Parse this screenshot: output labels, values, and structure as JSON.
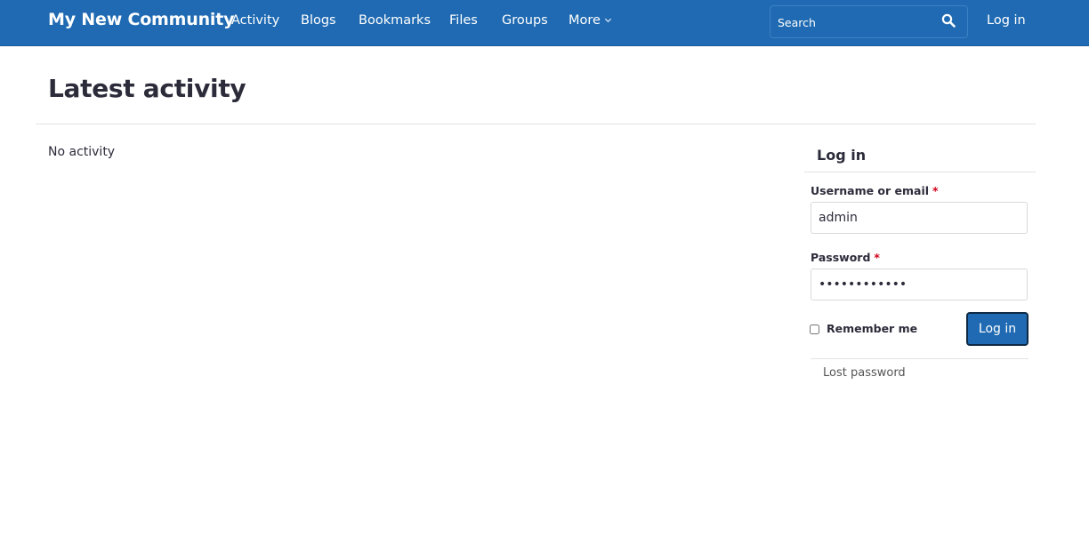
{
  "navbar": {
    "brand": "My New Community",
    "items": [
      {
        "label": "Activity"
      },
      {
        "label": "Blogs"
      },
      {
        "label": "Bookmarks"
      },
      {
        "label": "Files"
      },
      {
        "label": "Groups"
      },
      {
        "label": "More"
      }
    ],
    "search_placeholder": "Search",
    "search_icon": "search-icon",
    "login_label": "Log in",
    "background_color": "#1f6ab2"
  },
  "main": {
    "title": "Latest activity",
    "empty_text": "No activity"
  },
  "login_panel": {
    "heading": "Log in",
    "username_label": "Username or email",
    "username_value": "admin",
    "password_label": "Password",
    "password_value": "••••••••••••",
    "required_marker": "*",
    "remember_label": "Remember me",
    "remember_checked": false,
    "submit_label": "Log in",
    "lost_password_label": "Lost password"
  }
}
